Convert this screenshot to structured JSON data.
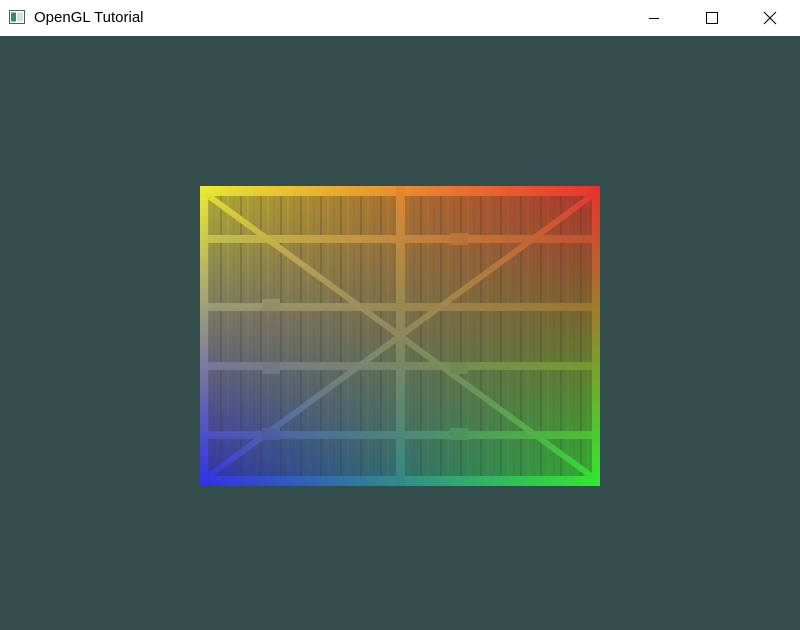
{
  "window": {
    "title": "OpenGL Tutorial",
    "icon": "app-window-icon",
    "controls": {
      "minimize_icon": "minimize-icon",
      "maximize_icon": "maximize-icon",
      "close_icon": "close-icon"
    }
  },
  "render": {
    "clear_color": "#334d4d",
    "quad": {
      "texture": "wooden-crate-texture",
      "corner_colors": {
        "top_left": "#ffff00",
        "top_right": "#ff0000",
        "bottom_left": "#0000ff",
        "bottom_right": "#00ff00"
      }
    }
  }
}
